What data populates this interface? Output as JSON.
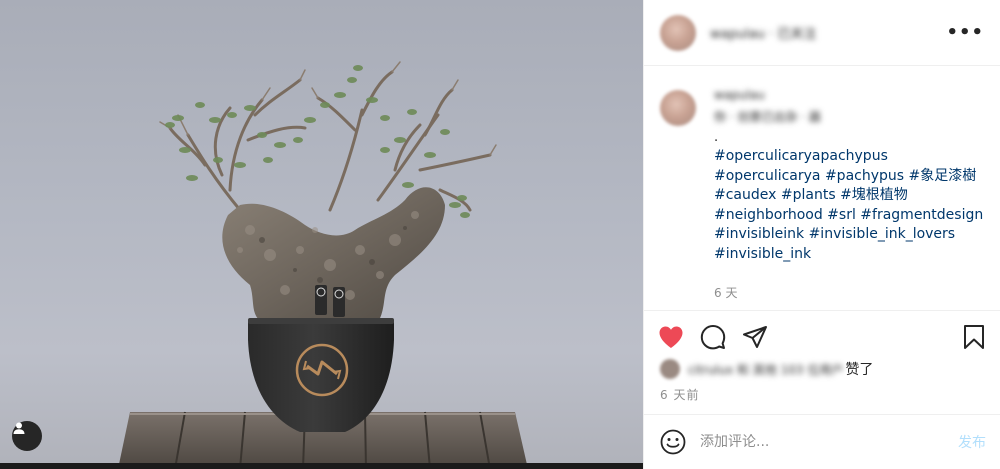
{
  "post": {
    "author_username": "wapulau · 已关注",
    "caption_author": "wapulau",
    "caption_subtitle": "你 · 创意已出杂 · 器",
    "caption_dot": ".",
    "caption_tag_lines": [
      [
        "#operculicaryapachypus"
      ],
      [
        "#operculicarya",
        "#pachypus",
        "#象足漆樹"
      ],
      [
        "#caudex",
        "#plants",
        "#塊根植物"
      ],
      [
        "#neighborhood",
        "#srl",
        "#fragmentdesign"
      ],
      [
        "#invisibleink",
        "#invisible_ink_lovers"
      ],
      [
        "#invisible_ink"
      ]
    ],
    "caption_age": "6 天",
    "likes_names": "citrulux 和 其他 103 位用户",
    "likes_suffix": "赞了",
    "timestamp": "6 天前"
  },
  "comment_box": {
    "placeholder": "添加评论...",
    "post_label": "发布"
  },
  "icons": {
    "more": "more-options-icon",
    "like": "heart-icon",
    "comment": "comment-icon",
    "share": "share-icon",
    "save": "bookmark-icon",
    "emoji": "emoji-icon",
    "user_tags": "user-tags-icon"
  },
  "colors": {
    "liked_heart": "#ed4956",
    "hashtag": "#00376b",
    "muted": "#8e8e8e",
    "post_button_disabled": "#b2dffc"
  }
}
